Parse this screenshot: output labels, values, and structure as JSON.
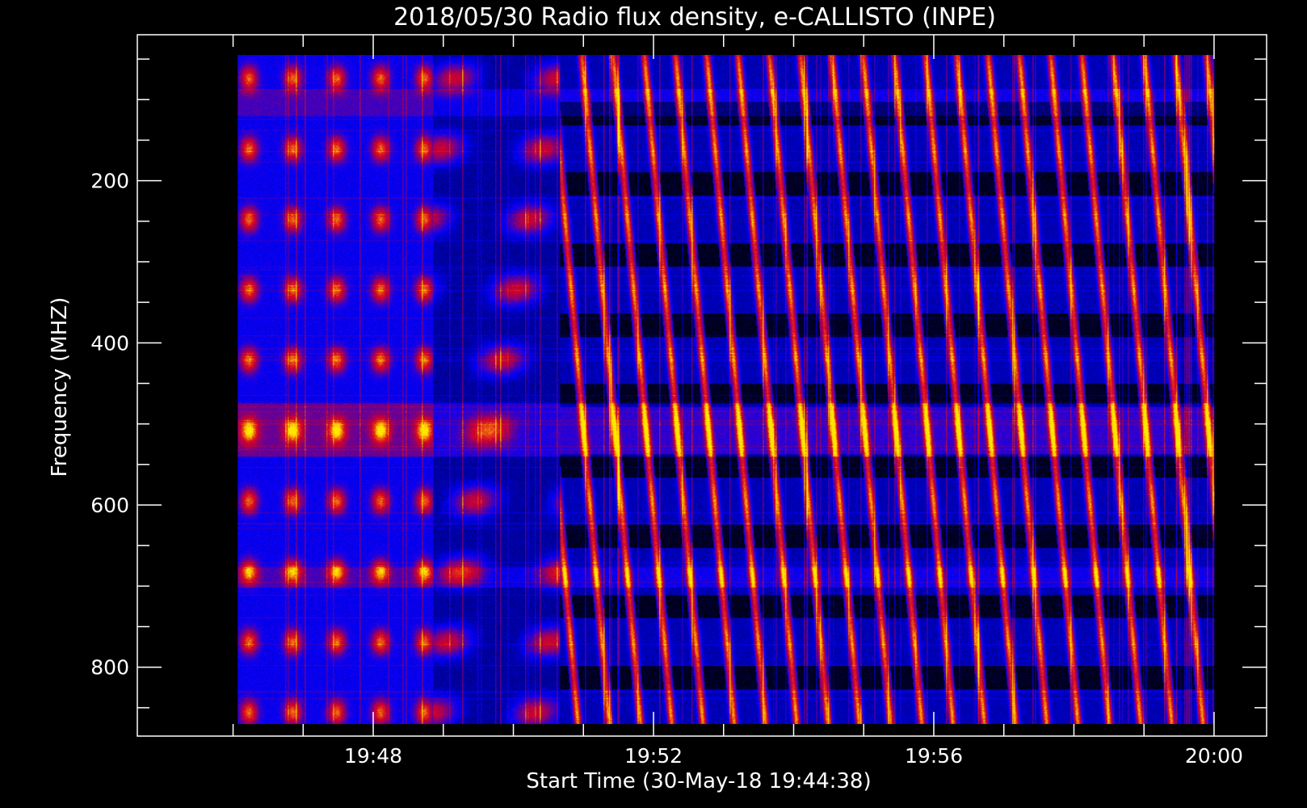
{
  "chart_data": {
    "type": "heatmap",
    "title": "2018/05/30  Radio flux density, e-CALLISTO (INPE)",
    "xlabel": "Start Time (30-May-18 19:44:38)",
    "ylabel": "Frequency (MHZ)",
    "x_range": [
      "19:46:04",
      "20:00:00"
    ],
    "x_axis_range": [
      "19:44:38",
      "20:00:45"
    ],
    "y_range": [
      45,
      870
    ],
    "y_axis_range": [
      20,
      885
    ],
    "y_inverted": true,
    "x_ticks": [
      "19:48",
      "19:52",
      "19:56",
      "20:00"
    ],
    "y_ticks": [
      200,
      400,
      600,
      800
    ],
    "colormap": [
      "#000000",
      "#0000ff",
      "#ff0000",
      "#ffff00"
    ],
    "description_note": "Dynamic spectrum of radio flux density vs. time (x) and frequency (y); repeating drifting bursts appear as diagonal red streaks over a blue/black background."
  }
}
